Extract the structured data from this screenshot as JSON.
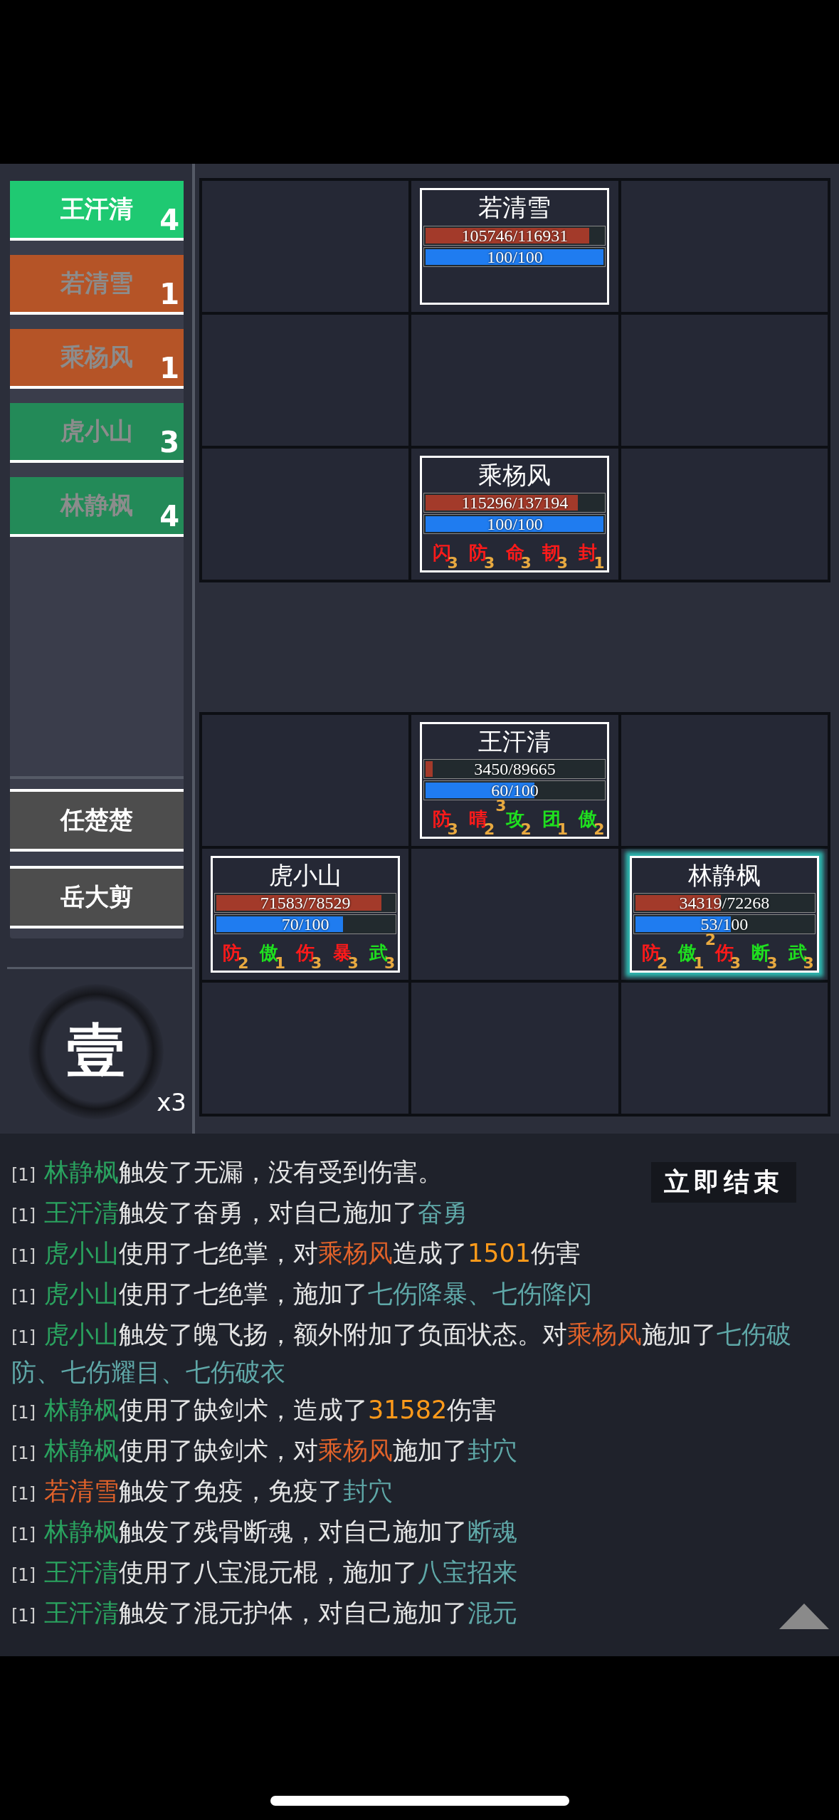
{
  "turn_order": [
    {
      "name": "王汗清",
      "count": "4",
      "color": "#1fc972",
      "selected": true
    },
    {
      "name": "若清雪",
      "count": "1",
      "color": "#b55427",
      "selected": false
    },
    {
      "name": "乘杨风",
      "count": "1",
      "color": "#b55427",
      "selected": false
    },
    {
      "name": "虎小山",
      "count": "3",
      "color": "#238a58",
      "selected": false
    },
    {
      "name": "林静枫",
      "count": "4",
      "color": "#238a58",
      "selected": false
    }
  ],
  "reserve": [
    {
      "name": "任楚楚"
    },
    {
      "name": "岳大剪"
    }
  ],
  "round": {
    "numeral": "壹",
    "multiplier": "x3"
  },
  "enemy_grid": [
    {
      "cells": [
        {
          "kind": "empty"
        },
        {
          "kind": "unit",
          "name": "若清雪",
          "hp": {
            "reading": "105746/116931",
            "level": 0.904
          },
          "mp": {
            "reading": "100/100",
            "level": 1
          },
          "selected": false
        },
        {
          "kind": "empty"
        }
      ]
    },
    {
      "cells": [
        {
          "kind": "empty"
        },
        {
          "kind": "empty"
        },
        {
          "kind": "empty"
        }
      ]
    },
    {
      "cells": [
        {
          "kind": "empty"
        },
        {
          "kind": "unit",
          "name": "乘杨风",
          "hp": {
            "reading": "115296/137194",
            "level": 0.84
          },
          "mp": {
            "reading": "100/100",
            "level": 1
          },
          "selected": false,
          "buffs": [
            {
              "label": "闪",
              "count": "3",
              "kind": "debuff"
            },
            {
              "label": "防",
              "count": "3",
              "kind": "debuff"
            },
            {
              "label": "命",
              "count": "3",
              "kind": "debuff"
            },
            {
              "label": "韧",
              "count": "3",
              "kind": "debuff"
            },
            {
              "label": "封",
              "count": "1",
              "kind": "debuff"
            }
          ]
        },
        {
          "kind": "empty"
        }
      ]
    }
  ],
  "player_grid": [
    {
      "cells": [
        {
          "kind": "empty"
        },
        {
          "kind": "unit",
          "name": "王汗清",
          "hp": {
            "reading": "3450/89665",
            "level": 0.038
          },
          "mp": {
            "reading": "60/100",
            "level": 0.6
          },
          "selected": false,
          "buffs": [
            {
              "label": "防",
              "count": "3",
              "kind": "debuff"
            },
            {
              "label": "晴",
              "count": "2",
              "kind": "debuff"
            },
            {
              "label": "攻",
              "count": "2",
              "stack": "3",
              "kind": "buff"
            },
            {
              "label": "团",
              "count": "1",
              "kind": "buff"
            },
            {
              "label": "傲",
              "count": "2",
              "kind": "buff"
            }
          ]
        },
        {
          "kind": "empty"
        }
      ]
    },
    {
      "cells": [
        {
          "kind": "unit",
          "name": "虎小山",
          "hp": {
            "reading": "71583/78529",
            "level": 0.912
          },
          "mp": {
            "reading": "70/100",
            "level": 0.7
          },
          "selected": false,
          "buffs": [
            {
              "label": "防",
              "count": "2",
              "kind": "debuff"
            },
            {
              "label": "傲",
              "count": "1",
              "kind": "buff"
            },
            {
              "label": "伤",
              "count": "3",
              "kind": "debuff"
            },
            {
              "label": "暴",
              "count": "3",
              "kind": "debuff"
            },
            {
              "label": "武",
              "count": "3",
              "kind": "buff"
            }
          ]
        },
        {
          "kind": "empty"
        },
        {
          "kind": "unit",
          "name": "林静枫",
          "hp": {
            "reading": "34319/72268",
            "level": 0.475
          },
          "mp": {
            "reading": "53/100",
            "level": 0.53
          },
          "selected": true,
          "buffs": [
            {
              "label": "防",
              "count": "2",
              "kind": "debuff"
            },
            {
              "label": "傲",
              "count": "1",
              "kind": "buff"
            },
            {
              "label": "伤",
              "count": "3",
              "stack": "2",
              "kind": "debuff"
            },
            {
              "label": "断",
              "count": "3",
              "kind": "buff"
            },
            {
              "label": "武",
              "count": "3",
              "kind": "buff"
            }
          ]
        }
      ]
    },
    {
      "cells": [
        {
          "kind": "empty"
        },
        {
          "kind": "empty"
        },
        {
          "kind": "empty"
        }
      ]
    }
  ],
  "end_now_button": "立即结束",
  "log": [
    {
      "tag": "[1]",
      "segments": [
        {
          "text": "林静枫",
          "kind": "ally"
        },
        {
          "text": "触发了无漏，没有受到伤害。",
          "kind": "plain"
        }
      ]
    },
    {
      "tag": "[1]",
      "segments": [
        {
          "text": "王汗清",
          "kind": "ally"
        },
        {
          "text": "触发了奋勇，对自己施加了",
          "kind": "plain"
        },
        {
          "text": "奋勇",
          "kind": "status"
        }
      ]
    },
    {
      "tag": "[1]",
      "segments": [
        {
          "text": "虎小山",
          "kind": "ally"
        },
        {
          "text": "使用了七绝掌，对",
          "kind": "plain"
        },
        {
          "text": "乘杨风",
          "kind": "enemy"
        },
        {
          "text": "造成了",
          "kind": "plain"
        },
        {
          "text": "1501",
          "kind": "number"
        },
        {
          "text": "伤害",
          "kind": "plain"
        }
      ]
    },
    {
      "tag": "[1]",
      "segments": [
        {
          "text": "虎小山",
          "kind": "ally"
        },
        {
          "text": "使用了七绝掌，施加了",
          "kind": "plain"
        },
        {
          "text": "七伤降暴、七伤降闪",
          "kind": "status"
        }
      ]
    },
    {
      "tag": "[1]",
      "segments": [
        {
          "text": "虎小山",
          "kind": "ally"
        },
        {
          "text": "触发了魄飞扬，额外附加了负面状态。对",
          "kind": "plain"
        },
        {
          "text": "乘杨风",
          "kind": "enemy"
        },
        {
          "text": "施加了",
          "kind": "plain"
        },
        {
          "text": "七伤破防、七伤耀目、七伤破衣",
          "kind": "status"
        }
      ]
    },
    {
      "tag": "[1]",
      "segments": [
        {
          "text": "林静枫",
          "kind": "ally"
        },
        {
          "text": "使用了缺剑术，造成了",
          "kind": "plain"
        },
        {
          "text": "31582",
          "kind": "number"
        },
        {
          "text": "伤害",
          "kind": "plain"
        }
      ]
    },
    {
      "tag": "[1]",
      "segments": [
        {
          "text": "林静枫",
          "kind": "ally"
        },
        {
          "text": "使用了缺剑术，对",
          "kind": "plain"
        },
        {
          "text": "乘杨风",
          "kind": "enemy"
        },
        {
          "text": "施加了",
          "kind": "plain"
        },
        {
          "text": "封穴",
          "kind": "status"
        }
      ]
    },
    {
      "tag": "[1]",
      "segments": [
        {
          "text": "若清雪",
          "kind": "enemy"
        },
        {
          "text": "触发了免疫，免疫了",
          "kind": "plain"
        },
        {
          "text": "封穴",
          "kind": "status"
        }
      ]
    },
    {
      "tag": "[1]",
      "segments": [
        {
          "text": "林静枫",
          "kind": "ally"
        },
        {
          "text": "触发了残骨断魂，对自己施加了",
          "kind": "plain"
        },
        {
          "text": "断魂",
          "kind": "status"
        }
      ]
    },
    {
      "tag": "[1]",
      "segments": [
        {
          "text": "王汗清",
          "kind": "ally"
        },
        {
          "text": "使用了八宝混元棍，施加了",
          "kind": "plain"
        },
        {
          "text": "八宝招来",
          "kind": "status"
        }
      ]
    },
    {
      "tag": "[1]",
      "segments": [
        {
          "text": "王汗清",
          "kind": "ally"
        },
        {
          "text": "触发了混元护体，对自己施加了",
          "kind": "plain"
        },
        {
          "text": "混元",
          "kind": "status"
        }
      ]
    }
  ]
}
